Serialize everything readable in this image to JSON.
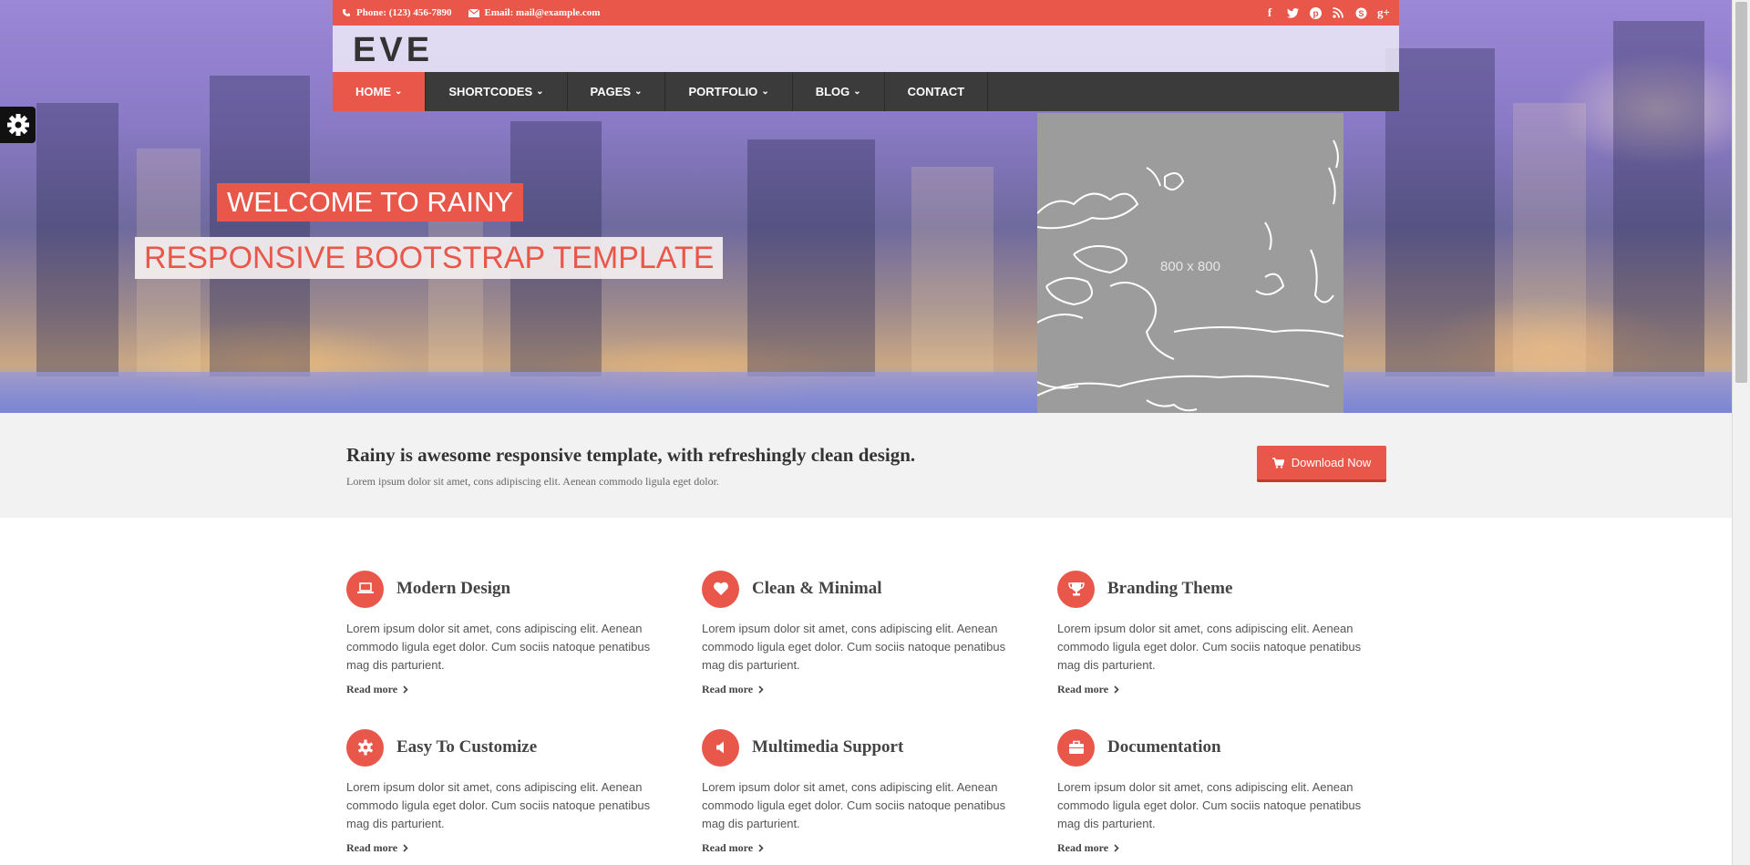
{
  "topbar": {
    "phone": "Phone: (123) 456-7890",
    "email": "Email: mail@example.com",
    "social_icons": [
      "facebook-icon",
      "twitter-icon",
      "pinterest-icon",
      "rss-icon",
      "skype-icon",
      "google-plus-icon"
    ]
  },
  "logo": "EVE",
  "nav": {
    "items": [
      {
        "label": "HOME",
        "dropdown": true,
        "active": true
      },
      {
        "label": "SHORTCODES",
        "dropdown": true
      },
      {
        "label": "PAGES",
        "dropdown": true
      },
      {
        "label": "PORTFOLIO",
        "dropdown": true
      },
      {
        "label": "BLOG",
        "dropdown": true
      },
      {
        "label": "CONTACT",
        "dropdown": false
      }
    ]
  },
  "slider": {
    "title": "WELCOME TO RAINY",
    "subtitle": "RESPONSIVE BOOTSTRAP TEMPLATE",
    "image_placeholder": "800 x 800"
  },
  "promo": {
    "title": "Rainy is awesome responsive template, with refreshingly clean design.",
    "text": "Lorem ipsum dolor sit amet, cons adipiscing elit. Aenean commodo ligula eget dolor.",
    "button_label": "Download Now"
  },
  "features": [
    {
      "icon": "laptop-icon",
      "title": "Modern Design",
      "text": "Lorem ipsum dolor sit amet, cons adipiscing elit. Aenean commodo ligula eget dolor. Cum sociis natoque penatibus mag dis parturient.",
      "more": "Read more"
    },
    {
      "icon": "heart-icon",
      "title": "Clean & Minimal",
      "text": "Lorem ipsum dolor sit amet, cons adipiscing elit. Aenean commodo ligula eget dolor. Cum sociis natoque penatibus mag dis parturient.",
      "more": "Read more"
    },
    {
      "icon": "trophy-icon",
      "title": "Branding Theme",
      "text": "Lorem ipsum dolor sit amet, cons adipiscing elit. Aenean commodo ligula eget dolor. Cum sociis natoque penatibus mag dis parturient.",
      "more": "Read more"
    },
    {
      "icon": "gear-icon",
      "title": "Easy To Customize",
      "text": "Lorem ipsum dolor sit amet, cons adipiscing elit. Aenean commodo ligula eget dolor. Cum sociis natoque penatibus mag dis parturient.",
      "more": "Read more"
    },
    {
      "icon": "volume-icon",
      "title": "Multimedia Support",
      "text": "Lorem ipsum dolor sit amet, cons adipiscing elit. Aenean commodo ligula eget dolor. Cum sociis natoque penatibus mag dis parturient.",
      "more": "Read more"
    },
    {
      "icon": "briefcase-icon",
      "title": "Documentation",
      "text": "Lorem ipsum dolor sit amet, cons adipiscing elit. Aenean commodo ligula eget dolor. Cum sociis natoque penatibus mag dis parturient.",
      "more": "Read more"
    }
  ],
  "colors": {
    "accent": "#e8574a",
    "nav_bg": "#3b3b3b",
    "promo_bg": "#f2f2f2"
  }
}
